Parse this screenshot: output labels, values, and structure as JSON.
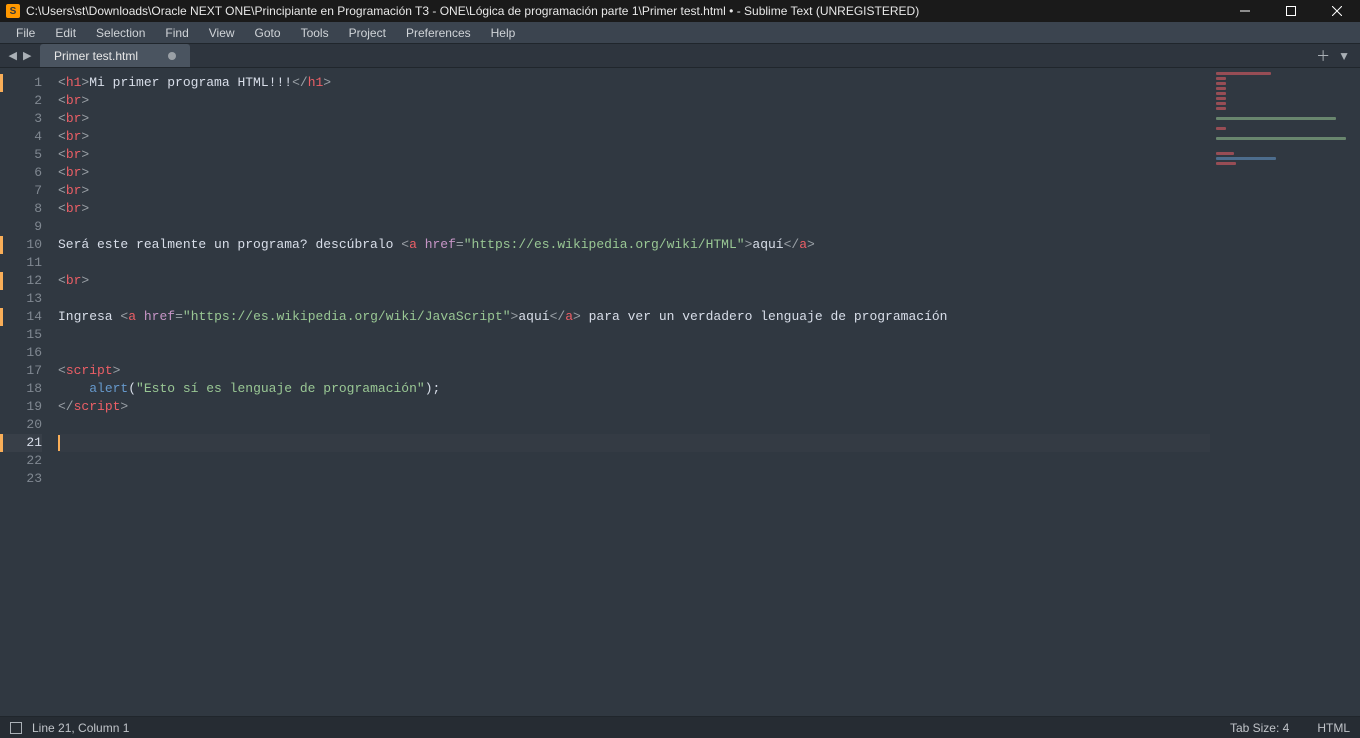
{
  "titlebar": {
    "path": "C:\\Users\\st\\Downloads\\Oracle NEXT ONE\\Principiante en Programación T3 - ONE\\Lógica de programación parte 1\\Primer test.html • - Sublime Text (UNREGISTERED)",
    "app_icon_letter": "S"
  },
  "menu": [
    "File",
    "Edit",
    "Selection",
    "Find",
    "View",
    "Goto",
    "Tools",
    "Project",
    "Preferences",
    "Help"
  ],
  "tab": {
    "name": "Primer test.html",
    "dirty": true
  },
  "gutter": {
    "total_lines": 23,
    "active": 21,
    "marks": [
      1,
      10,
      12,
      14,
      21
    ]
  },
  "status": {
    "left": "Line 21, Column 1",
    "tab_size": "Tab Size: 4",
    "syntax": "HTML"
  },
  "code": {
    "lines": [
      [
        [
          "pun",
          "<"
        ],
        [
          "tag",
          "h1"
        ],
        [
          "pun",
          ">"
        ],
        [
          "txt",
          "Mi primer programa HTML!!!"
        ],
        [
          "pun",
          "</"
        ],
        [
          "tag",
          "h1"
        ],
        [
          "pun",
          ">"
        ]
      ],
      [
        [
          "pun",
          "<"
        ],
        [
          "tag",
          "br"
        ],
        [
          "pun",
          ">"
        ]
      ],
      [
        [
          "pun",
          "<"
        ],
        [
          "tag",
          "br"
        ],
        [
          "pun",
          ">"
        ]
      ],
      [
        [
          "pun",
          "<"
        ],
        [
          "tag",
          "br"
        ],
        [
          "pun",
          ">"
        ]
      ],
      [
        [
          "pun",
          "<"
        ],
        [
          "tag",
          "br"
        ],
        [
          "pun",
          ">"
        ]
      ],
      [
        [
          "pun",
          "<"
        ],
        [
          "tag",
          "br"
        ],
        [
          "pun",
          ">"
        ]
      ],
      [
        [
          "pun",
          "<"
        ],
        [
          "tag",
          "br"
        ],
        [
          "pun",
          ">"
        ]
      ],
      [
        [
          "pun",
          "<"
        ],
        [
          "tag",
          "br"
        ],
        [
          "pun",
          ">"
        ]
      ],
      [],
      [
        [
          "txt",
          "Será este realmente un programa? descúbralo "
        ],
        [
          "pun",
          "<"
        ],
        [
          "tag",
          "a"
        ],
        [
          "txt",
          " "
        ],
        [
          "attr",
          "href"
        ],
        [
          "pun",
          "="
        ],
        [
          "str",
          "\"https://es.wikipedia.org/wiki/HTML\""
        ],
        [
          "pun",
          ">"
        ],
        [
          "txt",
          "aquí"
        ],
        [
          "pun",
          "</"
        ],
        [
          "tag",
          "a"
        ],
        [
          "pun",
          ">"
        ]
      ],
      [],
      [
        [
          "pun",
          "<"
        ],
        [
          "tag",
          "br"
        ],
        [
          "pun",
          ">"
        ]
      ],
      [],
      [
        [
          "txt",
          "Ingresa "
        ],
        [
          "pun",
          "<"
        ],
        [
          "tag",
          "a"
        ],
        [
          "txt",
          " "
        ],
        [
          "attr",
          "href"
        ],
        [
          "pun",
          "="
        ],
        [
          "str",
          "\"https://es.wikipedia.org/wiki/JavaScript\""
        ],
        [
          "pun",
          ">"
        ],
        [
          "txt",
          "aquí"
        ],
        [
          "pun",
          "</"
        ],
        [
          "tag",
          "a"
        ],
        [
          "pun",
          ">"
        ],
        [
          "txt",
          " para ver un verdadero lenguaje de programacíón"
        ]
      ],
      [],
      [],
      [
        [
          "pun",
          "<"
        ],
        [
          "tag",
          "script"
        ],
        [
          "pun",
          ">"
        ]
      ],
      [
        [
          "txt",
          "    "
        ],
        [
          "fn",
          "alert"
        ],
        [
          "txt",
          "("
        ],
        [
          "str",
          "\"Esto sí es lenguaje de programación\""
        ],
        [
          "txt",
          ");"
        ]
      ],
      [
        [
          "pun",
          "</"
        ],
        [
          "tag",
          "script"
        ],
        [
          "pun",
          ">"
        ]
      ],
      [],
      [],
      [],
      []
    ]
  },
  "minimap_widths": [
    55,
    10,
    10,
    10,
    10,
    10,
    10,
    10,
    0,
    120,
    0,
    10,
    0,
    130,
    0,
    0,
    18,
    60,
    20,
    0,
    0,
    0,
    0
  ],
  "minimap_colors": [
    "#ec5f66",
    "#ec5f66",
    "#ec5f66",
    "#ec5f66",
    "#ec5f66",
    "#ec5f66",
    "#ec5f66",
    "#ec5f66",
    "",
    "#99c794",
    "",
    "#ec5f66",
    "",
    "#99c794",
    "",
    "",
    "#ec5f66",
    "#6699cc",
    "#ec5f66",
    "",
    "",
    "",
    ""
  ]
}
